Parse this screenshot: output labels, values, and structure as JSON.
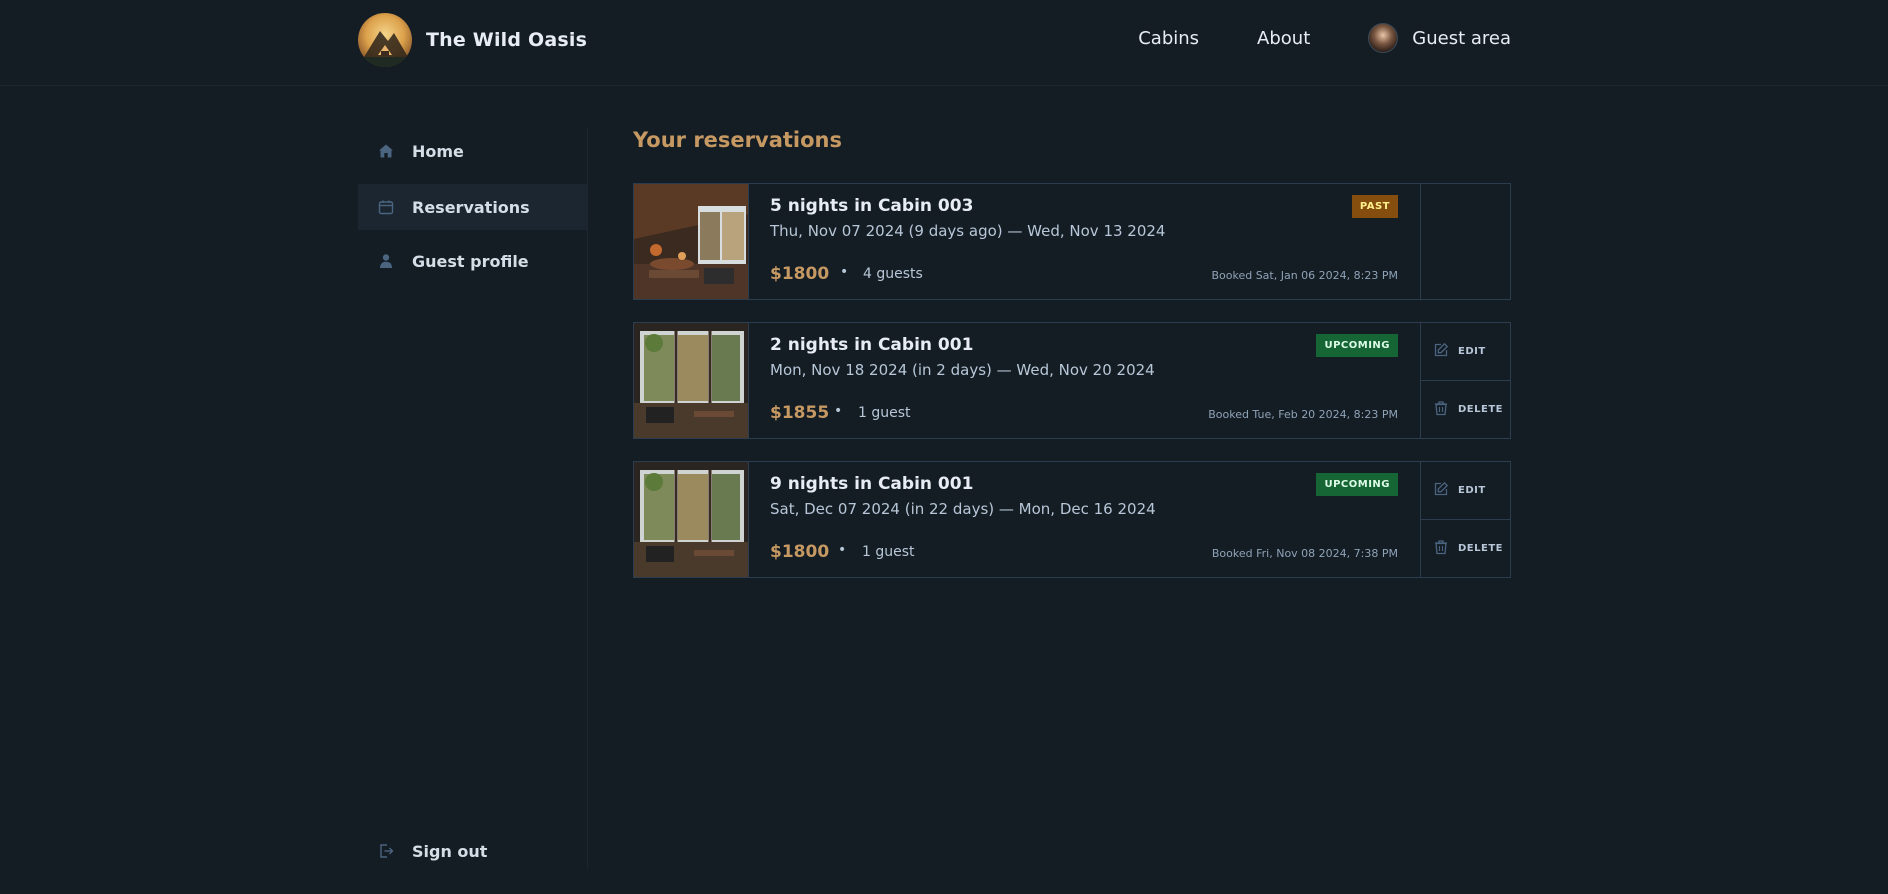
{
  "header": {
    "brand": "The Wild Oasis",
    "nav": {
      "cabins": "Cabins",
      "about": "About",
      "guest_area": "Guest area"
    }
  },
  "sidebar": {
    "items": [
      {
        "label": "Home",
        "icon": "home-icon"
      },
      {
        "label": "Reservations",
        "icon": "calendar-icon",
        "active": true
      },
      {
        "label": "Guest profile",
        "icon": "user-icon"
      }
    ],
    "sign_out": "Sign out"
  },
  "main": {
    "title": "Your reservations",
    "reservations": [
      {
        "title": "5 nights in Cabin 003",
        "dates": "Thu, Nov 07 2024 (9 days ago) — Wed, Nov 13 2024",
        "price": "$1800",
        "separator": "•",
        "guests": "4 guests",
        "booked": "Booked Sat, Jan 06 2024, 8:23 PM",
        "status": "PAST"
      },
      {
        "title": "2 nights in Cabin 001",
        "dates": "Mon, Nov 18 2024 (in 2 days) — Wed, Nov 20 2024",
        "price": "$1855",
        "separator": "•",
        "guests": "1 guest",
        "booked": "Booked Tue, Feb 20 2024, 8:23 PM",
        "status": "UPCOMING",
        "edit": "EDIT",
        "delete": "DELETE"
      },
      {
        "title": "9 nights in Cabin 001",
        "dates": "Sat, Dec 07 2024 (in 22 days) — Mon, Dec 16 2024",
        "price": "$1800",
        "separator": "•",
        "guests": "1 guest",
        "booked": "Booked Fri, Nov 08 2024, 7:38 PM",
        "status": "UPCOMING",
        "edit": "EDIT",
        "delete": "DELETE"
      }
    ]
  },
  "colors": {
    "background": "#141c24",
    "accent": "#c69963",
    "past_badge": "#854d0e",
    "upcoming_badge": "#166534"
  }
}
